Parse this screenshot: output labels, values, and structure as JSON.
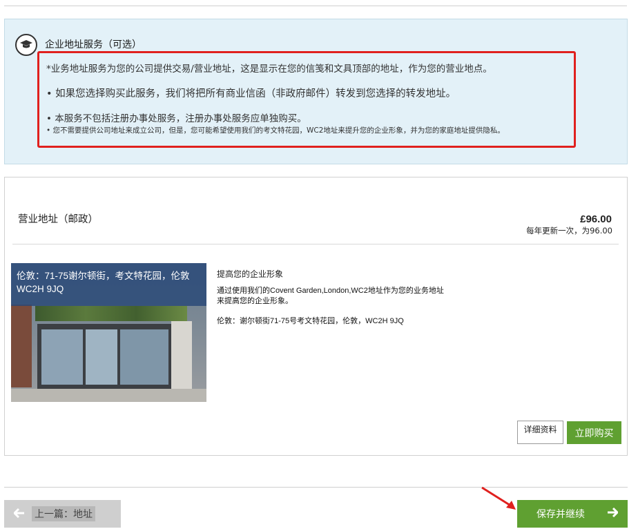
{
  "info": {
    "title": "企业地址服务（可选）",
    "line1": "*业务地址服务为您的公司提供交易/营业地址，这是显示在您的信笺和文具顶部的地址，作为您的营业地点。",
    "line2": "• 如果您选择购买此服务，我们将把所有商业信函（非政府邮件）转发到您选择的转发地址。",
    "line3": "• 本服务不包括注册办事处服务，注册办事处服务应单独购买。",
    "line4": "• 您不需要提供公司地址来成立公司，但是，您可能希望使用我们的考文特花园，WC2地址来提升您的企业形象，并为您的家庭地址提供隐私。"
  },
  "product": {
    "name": "营业地址（邮政）",
    "price": "£96.00",
    "price_note": "每年更新一次，为96.00",
    "photo_caption": "伦敦：71-75谢尔顿街，考文特花园，伦敦 WC2H 9JQ",
    "desc_title": "提高您的企业形象",
    "desc_text": "通过使用我们的Covent Garden,London,WC2地址作为您的业务地址\n来提高您的企业形象。",
    "address": "伦敦：谢尔顿街71-75号考文特花园，伦敦，WC2H 9JQ",
    "details_label": "详细资料",
    "buy_label": "立即购买"
  },
  "nav": {
    "prev_label": "上一篇：地址",
    "save_label": "保存并继续"
  },
  "colors": {
    "panel_bg": "#e3f1f8",
    "highlight": "#e0201e",
    "accent_green": "#5fa031"
  },
  "icons": {
    "info": "graduation-cap-icon",
    "prev": "arrow-left-icon",
    "next": "arrow-right-icon"
  }
}
